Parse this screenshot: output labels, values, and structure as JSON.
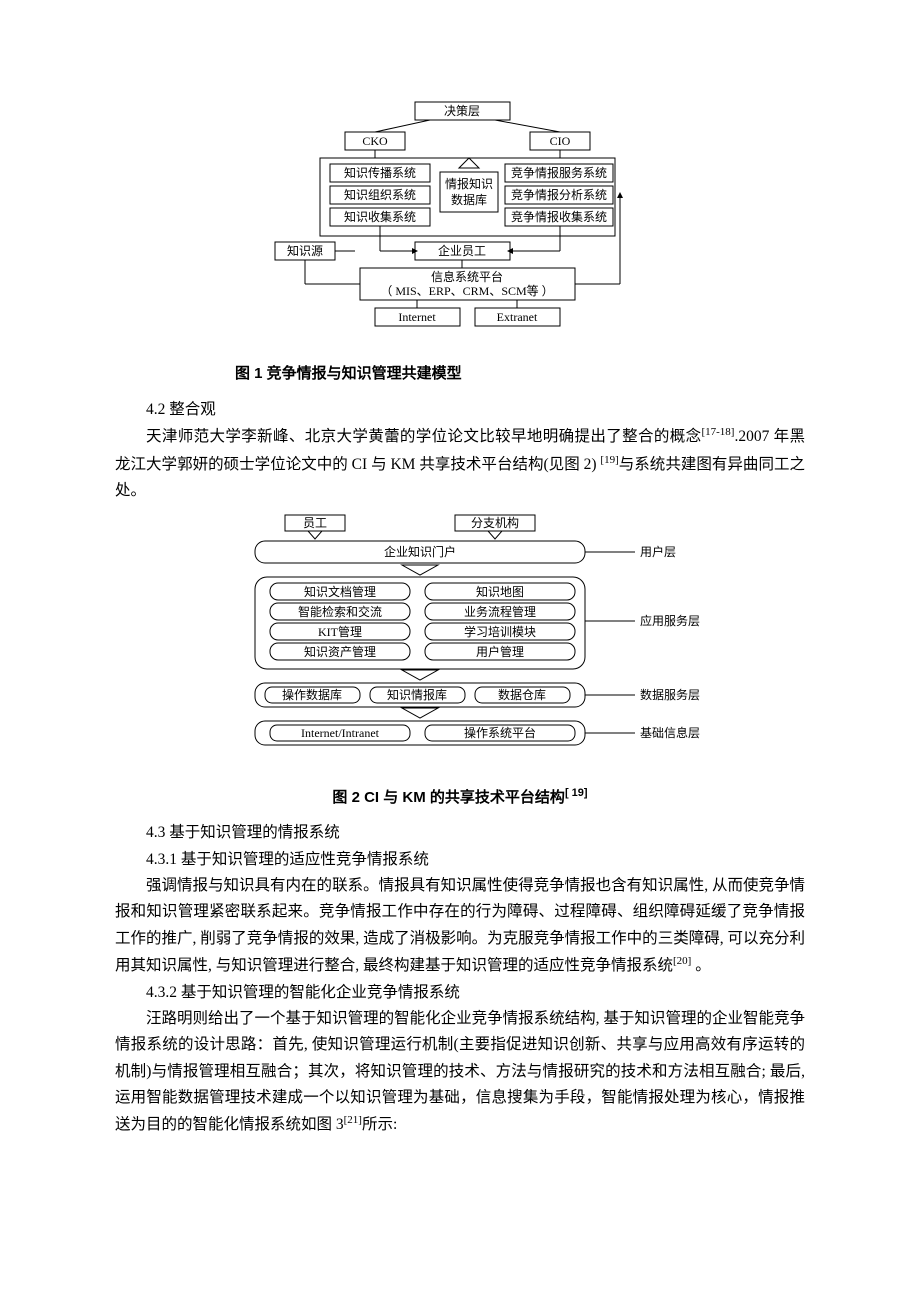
{
  "fig1": {
    "caption": "图 1 竞争情报与知识管理共建模型",
    "top": "决策层",
    "cko": "CKO",
    "cio": "CIO",
    "left": [
      "知识传播系统",
      "知识组织系统",
      "知识收集系统"
    ],
    "center_top": "情报知识",
    "center_bot": "数据库",
    "right": [
      "竞争情报服务系统",
      "竞争情报分析系统",
      "竞争情报收集系统"
    ],
    "kn_src": "知识源",
    "employees": "企业员工",
    "platform_top": "信息系统平台",
    "platform_bot": "（ MIS、ERP、CRM、SCM等 ）",
    "internet": "Internet",
    "extranet": "Extranet"
  },
  "sec42_head": "4.2 整合观",
  "sec42_p1a": "天津师范大学李新峰、北京大学黄蕾的学位论文比较早地明确提出了整合的概念",
  "sec42_cite1": "[17-18]",
  "sec42_p1b": ".2007 年黑龙江大学郭妍的硕士学位论文中的 CI 与 KM  共享技术平台结构(见图 2) ",
  "sec42_cite2": "[19]",
  "sec42_p1c": "与系统共建图有异曲同工之处。",
  "fig2": {
    "caption_a": "图 2   CI 与 KM  的共享技术平台结构",
    "caption_cite": "[ 19]",
    "emp": "员工",
    "branch": "分支机构",
    "portal": "企业知识门户",
    "userlayer": "用户层",
    "left": [
      "知识文档管理",
      "智能检索和交流",
      "KIT管理",
      "知识资产管理"
    ],
    "right": [
      "知识地图",
      "业务流程管理",
      "学习培训模块",
      "用户管理"
    ],
    "appsvc": "应用服务层",
    "opdb": "操作数据库",
    "kb": "知识情报库",
    "dw": "数据仓库",
    "datasvc": "数据服务层",
    "inet": "Internet/Intranet",
    "osplat": "操作系统平台",
    "baseinfo": "基础信息层"
  },
  "sec43_head": "4.3 基于知识管理的情报系统",
  "sec431_head": "4.3.1 基于知识管理的适应性竞争情报系统",
  "sec431_p": "强调情报与知识具有内在的联系。情报具有知识属性使得竞争情报也含有知识属性, 从而使竞争情报和知识管理紧密联系起来。竞争情报工作中存在的行为障碍、过程障碍、组织障碍延缓了竞争情报工作的推广, 削弱了竞争情报的效果, 造成了消极影响。为克服竞争情报工作中的三类障碍, 可以充分利用其知识属性, 与知识管理进行整合, 最终构建基于知识管理的适应性竞争情报系统",
  "sec431_cite": "[20]",
  "sec431_end": " 。",
  "sec432_head": "4.3.2 基于知识管理的智能化企业竞争情报系统",
  "sec432_p": "汪路明则给出了一个基于知识管理的智能化企业竞争情报系统结构, 基于知识管理的企业智能竞争情报系统的设计思路：首先, 使知识管理运行机制(主要指促进知识创新、共享与应用高效有序运转的机制)与情报管理相互融合；其次，将知识管理的技术、方法与情报研究的技术和方法相互融合; 最后, 运用智能数据管理技术建成一个以知识管理为基础，信息搜集为手段，智能情报处理为核心，情报推送为目的的智能化情报系统如图 3",
  "sec432_cite": "[21]",
  "sec432_end": "所示:"
}
